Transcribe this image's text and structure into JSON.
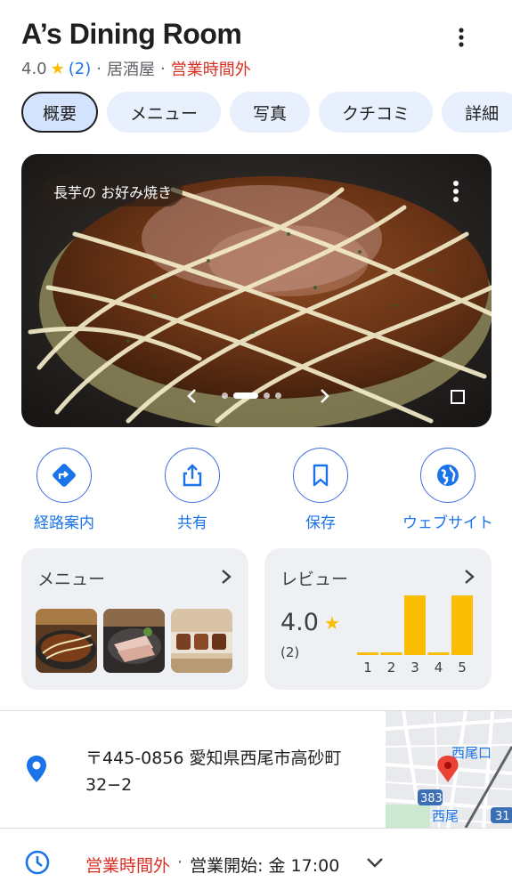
{
  "place": {
    "name": "A’s Dining Room",
    "rating": "4.0",
    "review_count": "(2)",
    "category": "居酒屋",
    "status": "営業時間外",
    "separator": "·"
  },
  "tabs": [
    {
      "label": "概要",
      "active": true
    },
    {
      "label": "メニュー",
      "active": false
    },
    {
      "label": "写真",
      "active": false
    },
    {
      "label": "クチコミ",
      "active": false
    },
    {
      "label": "詳細",
      "active": false
    }
  ],
  "photo": {
    "caption": "長芋の お好み焼き",
    "slide_index": 1,
    "slide_total": 4
  },
  "actions": [
    {
      "label": "経路案内",
      "icon": "directions-icon"
    },
    {
      "label": "共有",
      "icon": "share-icon"
    },
    {
      "label": "保存",
      "icon": "bookmark-icon"
    },
    {
      "label": "ウェブサイト",
      "icon": "globe-icon"
    }
  ],
  "menu_card": {
    "title": "メニュー"
  },
  "review_card": {
    "title": "レビュー",
    "rating": "4.0",
    "count": "(2)",
    "distribution": [
      {
        "stars": "1",
        "share": 0
      },
      {
        "stars": "2",
        "share": 0
      },
      {
        "stars": "3",
        "share": 0.5
      },
      {
        "stars": "4",
        "share": 0
      },
      {
        "stars": "5",
        "share": 0.5
      }
    ]
  },
  "address": {
    "line1": "〒445-0856 愛知県西尾市高砂町",
    "line2": "32−2"
  },
  "map": {
    "labels": [
      "西尾口",
      "383",
      "西尾",
      "31"
    ]
  },
  "hours": {
    "status": "営業時間外",
    "separator": "·",
    "opens": "営業開始: 金 17:00"
  },
  "colors": {
    "accent": "#1a73e8",
    "closed": "#d93025",
    "star": "#fbbc04",
    "bar": "#fbbc04",
    "tab_bg": "#e8f0fe"
  }
}
